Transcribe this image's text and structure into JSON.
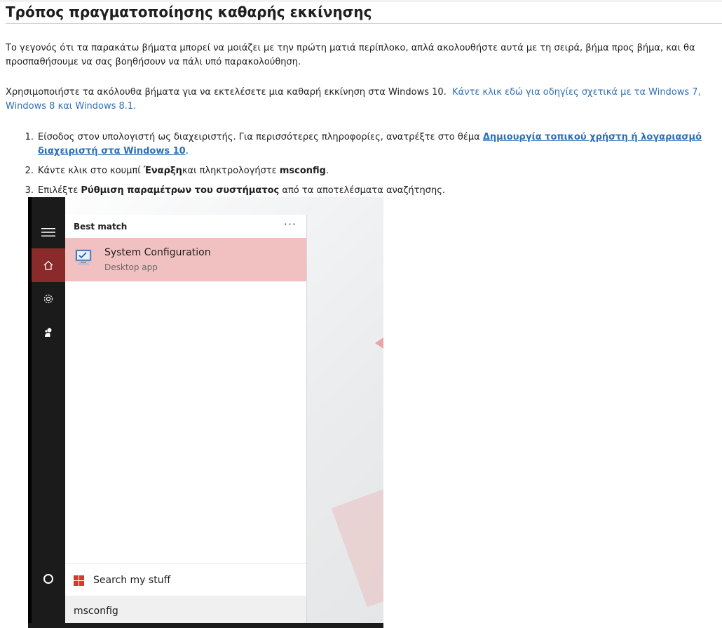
{
  "page": {
    "title": "Τρόπος πραγματοποίησης καθαρής εκκίνησης",
    "intro": "Το γεγονός ότι τα παρακάτω βήματα μπορεί να μοιάζει με την πρώτη ματιά περίπλοκο, απλά ακολουθήστε αυτά με τη σειρά, βήμα προς βήμα, και θα προσπαθήσουμε να σας βοηθήσουν να πάλι υπό παρακολούθηση.",
    "instructions_text": "Χρησιμοποιήστε τα ακόλουθα βήματα για να εκτελέσετε μια καθαρή εκκίνηση στα Windows 10.",
    "instructions_link": "Κάντε κλικ εδώ για οδηγίες σχετικά με τα Windows 7, Windows 8 και Windows 8.1."
  },
  "steps": [
    {
      "num": "1.",
      "text": "Είσοδος στον υπολογιστή ως διαχειριστής.  Για περισσότερες πληροφορίες, ανατρέξτε στο θέμα ",
      "link": "Δημιουργία τοπικού χρήστη ή λογαριασμό διαχειριστή στα Windows 10",
      "tail": "."
    },
    {
      "num": "2.",
      "pre": "Κάντε κλικ στο κουμπί ",
      "bold1": "Έναρξη",
      "mid": "και πληκτρολογήστε ",
      "bold2": "msconfig",
      "tail": "."
    },
    {
      "num": "3.",
      "pre": "Επιλέξτε ",
      "bold1": "Ρύθμιση παραμέτρων του συστήματος",
      "tail": " από τα αποτελέσματα αναζήτησης."
    }
  ],
  "screenshot": {
    "best_match_label": "Best match",
    "more_label": "···",
    "result_name": "System Configuration",
    "result_sub": "Desktop app",
    "search_my_stuff": "Search my stuff",
    "search_query": "msconfig",
    "icons": [
      "hamburger-icon",
      "home-icon",
      "gear-icon",
      "person-icon",
      "cortana-circle-icon",
      "windows-logo-icon",
      "system-config-icon"
    ],
    "colors": {
      "highlight": "#f1c1c1",
      "rail": "#1b1b1b",
      "home_active": "#8b2a2a",
      "link": "#2f6fb6"
    }
  }
}
